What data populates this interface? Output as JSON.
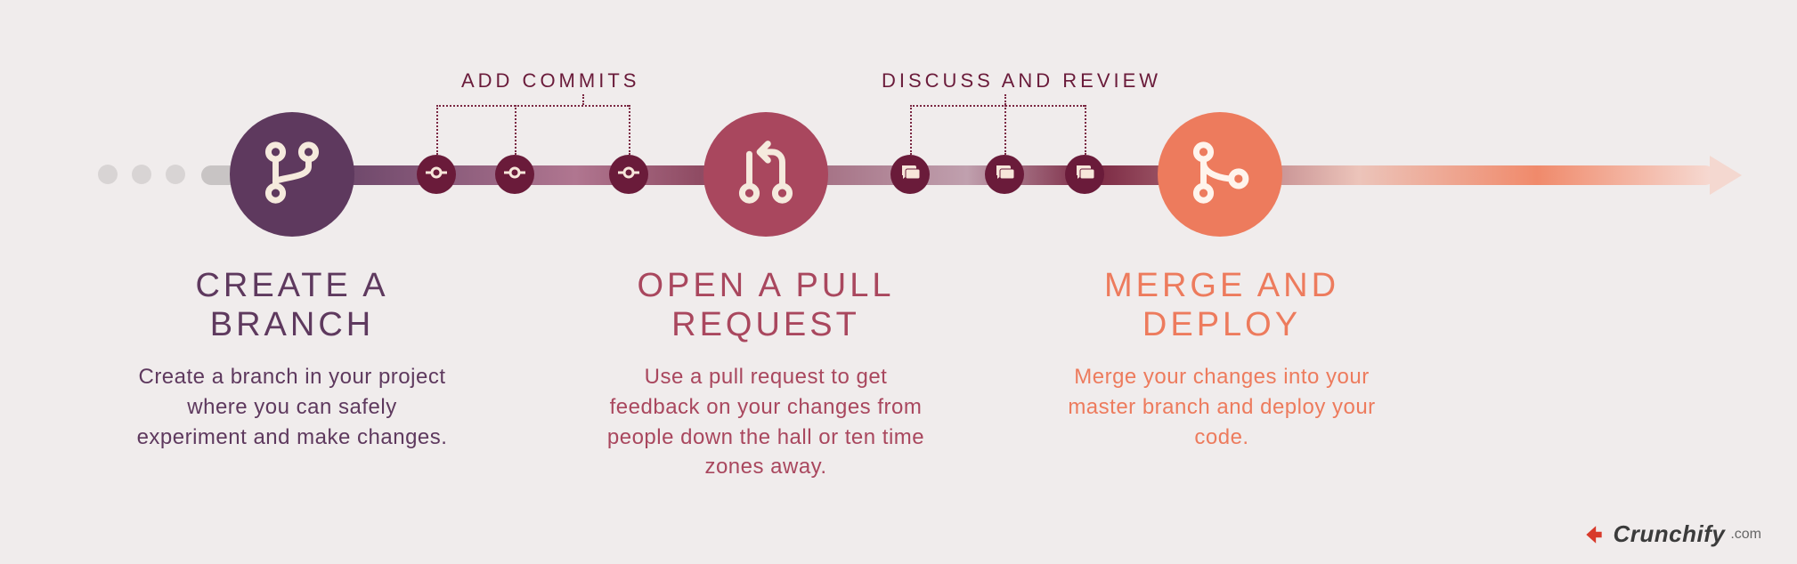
{
  "colors": {
    "branch": "#5e395e",
    "pr": "#a9475e",
    "merge": "#ed7b5d",
    "small": "#6a1b3a"
  },
  "groups": {
    "commits_label": "ADD COMMITS",
    "review_label": "DISCUSS AND REVIEW"
  },
  "steps": {
    "branch": {
      "title": "CREATE A BRANCH",
      "body": "Create a branch in your project where you can safely experiment and make changes."
    },
    "pr": {
      "title": "OPEN A PULL REQUEST",
      "body": "Use a pull request to get feedback on your changes from people down the hall or ten time zones away."
    },
    "merge": {
      "title": "MERGE AND DEPLOY",
      "body": "Merge your changes into your master branch and deploy your code."
    }
  },
  "watermark": {
    "brand": "Crunchify",
    "tld": ".com"
  }
}
